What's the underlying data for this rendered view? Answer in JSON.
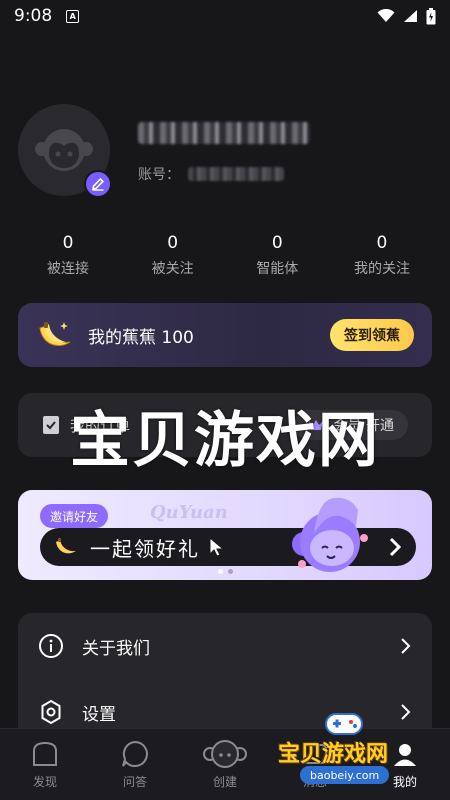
{
  "status": {
    "time": "9:08",
    "notif": "A"
  },
  "profile": {
    "account_label": "账号："
  },
  "stats": [
    {
      "value": "0",
      "label": "被连接"
    },
    {
      "value": "0",
      "label": "被关注"
    },
    {
      "value": "0",
      "label": "智能体"
    },
    {
      "value": "0",
      "label": "我的关注"
    }
  ],
  "banana": {
    "text": "我的蕉蕉 100",
    "button": "签到领蕉"
  },
  "orders": {
    "label": "我的订单",
    "vip_text": "会员 开通"
  },
  "watermark": {
    "big": "宝贝游戏网",
    "small": "宝贝游戏网",
    "url": "baobeiy.com"
  },
  "invite": {
    "tag": "邀请好友",
    "brand": "QuYuan",
    "text": "一起领好礼"
  },
  "menu": [
    {
      "label": "关于我们",
      "icon": "info-icon"
    },
    {
      "label": "设置",
      "icon": "settings-icon"
    }
  ],
  "tabs": [
    {
      "label": "发现",
      "icon": "discover-icon"
    },
    {
      "label": "问答",
      "icon": "chat-icon"
    },
    {
      "label": "创建",
      "icon": "create-icon"
    },
    {
      "label": "消息",
      "icon": "message-icon"
    },
    {
      "label": "我的",
      "icon": "profile-icon"
    }
  ],
  "colors": {
    "accent": "#7b5cff",
    "gold": "#ffd257",
    "bg": "#17171a"
  }
}
